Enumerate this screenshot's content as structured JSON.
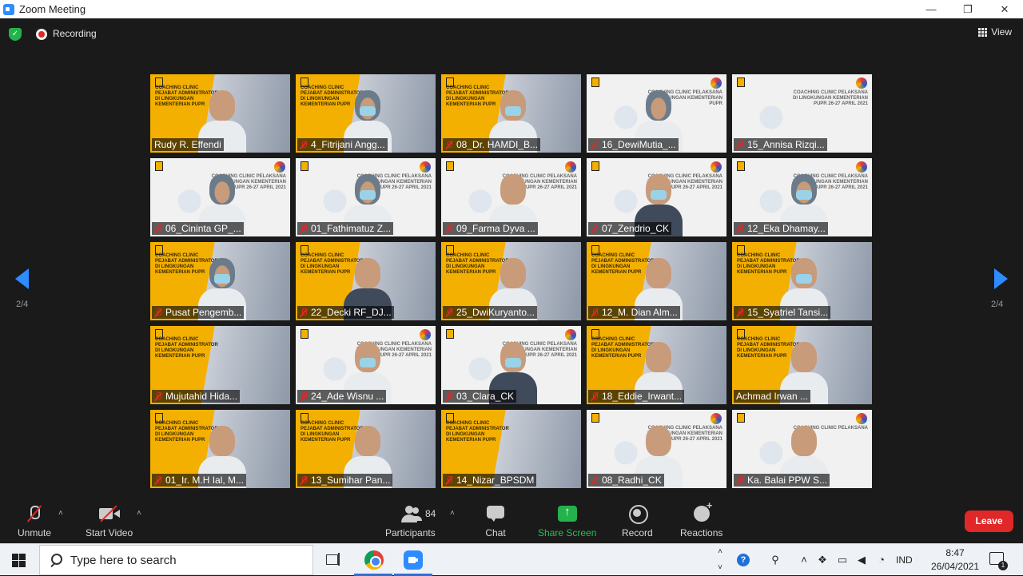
{
  "window": {
    "title": "Zoom Meeting",
    "minimize": "—",
    "restore": "❐",
    "close": "✕"
  },
  "meeting": {
    "recording_label": "Recording",
    "view_label": "View",
    "page_left": "2/4",
    "page_right": "2/4",
    "tiles": [
      {
        "name": "Rudy R. Effendi",
        "muted": false,
        "bg": "yellow",
        "banner": "COACHING CLINIC PEJABAT ADMINISTRATOR DI LINGKUNGAN KEMENTERIAN PUPR",
        "person": "plain",
        "mask": false
      },
      {
        "name": "4_Fitrijani Angg...",
        "muted": true,
        "bg": "yellow",
        "banner": "COACHING CLINIC PEJABAT ADMINISTRATOR DI LINGKUNGAN KEMENTERIAN PUPR",
        "person": "hijab",
        "mask": true
      },
      {
        "name": "08_Dr. HAMDI_B...",
        "muted": true,
        "bg": "yellow",
        "banner": "COACHING CLINIC PEJABAT ADMINISTRATOR DI LINGKUNGAN KEMENTERIAN PUPR",
        "person": "plain",
        "mask": true
      },
      {
        "name": "16_DewiMutia_...",
        "muted": true,
        "bg": "white",
        "banner": "COACHING CLINIC PELAKSANA DI LINGKUNGAN KEMENTERIAN PUPR",
        "person": "hijab",
        "mask": false
      },
      {
        "name": "15_Annisa Rizqi...",
        "muted": true,
        "bg": "white",
        "banner": "COACHING CLINIC PELAKSANA DI LINGKUNGAN KEMENTERIAN PUPR 26-27 APRIL 2021",
        "person": "none",
        "mask": false
      },
      {
        "name": "06_Cininta GP_...",
        "muted": true,
        "bg": "white",
        "banner": "COACHING CLINIC PELAKSANA DI LINGKUNGAN KEMENTERIAN PUPR 26-27 APRIL 2021",
        "person": "hijab",
        "mask": false
      },
      {
        "name": "01_Fathimatuz Z...",
        "muted": true,
        "bg": "white",
        "banner": "COACHING CLINIC PELAKSANA DI LINGKUNGAN KEMENTERIAN PUPR 26-27 APRIL 2021",
        "person": "hijab",
        "mask": true
      },
      {
        "name": "09_Farma Dyva ...",
        "muted": true,
        "bg": "white",
        "banner": "COACHING CLINIC PELAKSANA DI LINGKUNGAN KEMENTERIAN PUPR 26-27 APRIL 2021",
        "person": "plain",
        "mask": false
      },
      {
        "name": "07_Zendrio_CK",
        "muted": true,
        "bg": "white",
        "banner": "COACHING CLINIC PELAKSANA DI LINGKUNGAN KEMENTERIAN PUPR 26-27 APRIL 2021",
        "person": "dark",
        "mask": true
      },
      {
        "name": "12_Eka Dhamay...",
        "muted": true,
        "bg": "white",
        "banner": "COACHING CLINIC PELAKSANA DI LINGKUNGAN KEMENTERIAN PUPR 26-27 APRIL 2021",
        "person": "hijab",
        "mask": true
      },
      {
        "name": "Pusat Pengemb...",
        "muted": true,
        "bg": "yellow",
        "banner": "COACHING CLINIC PEJABAT ADMINISTRATOR DI LINGKUNGAN KEMENTERIAN PUPR",
        "person": "hijab",
        "mask": true
      },
      {
        "name": "22_Decki RF_DJ...",
        "muted": true,
        "bg": "yellow",
        "banner": "COACHING CLINIC PEJABAT ADMINISTRATOR DI LINGKUNGAN KEMENTERIAN PUPR",
        "person": "dark",
        "mask": false
      },
      {
        "name": "25_DwiKuryanto...",
        "muted": true,
        "bg": "yellow",
        "banner": "COACHING CLINIC PEJABAT ADMINISTRATOR DI LINGKUNGAN KEMENTERIAN PUPR",
        "person": "plain",
        "mask": false
      },
      {
        "name": "12_M. Dian Alm...",
        "muted": true,
        "bg": "yellow",
        "banner": "COACHING CLINIC PEJABAT ADMINISTRATOR DI LINGKUNGAN KEMENTERIAN PUPR",
        "person": "plain",
        "mask": false
      },
      {
        "name": "15_Syatriel Tansi...",
        "muted": true,
        "bg": "yellow",
        "banner": "COACHING CLINIC PEJABAT ADMINISTRATOR DI LINGKUNGAN KEMENTERIAN PUPR",
        "person": "plain",
        "mask": true
      },
      {
        "name": "Mujutahid Hida...",
        "muted": true,
        "bg": "yellow",
        "banner": "COACHING CLINIC PEJABAT ADMINISTRATOR DI LINGKUNGAN KEMENTERIAN PUPR",
        "person": "none",
        "mask": false
      },
      {
        "name": "24_Ade Wisnu ...",
        "muted": true,
        "bg": "white",
        "banner": "COACHING CLINIC PELAKSANA DI LINGKUNGAN KEMENTERIAN PUPR 26-27 APRIL 2021",
        "person": "plain",
        "mask": true
      },
      {
        "name": "03_Clara_CK",
        "muted": true,
        "bg": "white",
        "banner": "COACHING CLINIC PELAKSANA DI LINGKUNGAN KEMENTERIAN PUPR 26-27 APRIL 2021",
        "person": "dark",
        "mask": true
      },
      {
        "name": "18_Eddie_Irwant...",
        "muted": true,
        "bg": "yellow",
        "banner": "COACHING CLINIC PEJABAT ADMINISTRATOR DI LINGKUNGAN KEMENTERIAN PUPR",
        "person": "plain",
        "mask": false
      },
      {
        "name": "Achmad Irwan ...",
        "muted": false,
        "bg": "yellow",
        "banner": "COACHING CLINIC PEJABAT ADMINISTRATOR DI LINGKUNGAN KEMENTERIAN PUPR",
        "person": "plain",
        "mask": false
      },
      {
        "name": "01_Ir. M.H Ial, M...",
        "muted": true,
        "bg": "yellow",
        "banner": "COACHING CLINIC PEJABAT ADMINISTRATOR DI LINGKUNGAN KEMENTERIAN PUPR",
        "person": "plain",
        "mask": false
      },
      {
        "name": "13_Sumihar Pan...",
        "muted": true,
        "bg": "yellow",
        "banner": "COACHING CLINIC PEJABAT ADMINISTRATOR DI LINGKUNGAN KEMENTERIAN PUPR",
        "person": "plain",
        "mask": false
      },
      {
        "name": "14_Nizar_BPSDM",
        "muted": true,
        "bg": "yellow",
        "banner": "COACHING CLINIC PEJABAT ADMINISTRATOR DI LINGKUNGAN KEMENTERIAN PUPR",
        "person": "none",
        "mask": false
      },
      {
        "name": "08_Radhi_CK",
        "muted": true,
        "bg": "white",
        "banner": "COACHING CLINIC PELAKSANA DI LINGKUNGAN KEMENTERIAN PUPR 26-27 APRIL 2021",
        "person": "plain",
        "mask": false
      },
      {
        "name": "Ka. Balai PPW S...",
        "muted": true,
        "bg": "white",
        "banner": "COACHING CLINIC PELAKSANA",
        "person": "plain",
        "mask": false
      }
    ]
  },
  "toolbar": {
    "unmute": "Unmute",
    "start_video": "Start Video",
    "participants": "Participants",
    "participant_count": "84",
    "chat": "Chat",
    "share_screen": "Share Screen",
    "record": "Record",
    "reactions": "Reactions",
    "leave": "Leave",
    "caret": "˄"
  },
  "taskbar": {
    "search_placeholder": "Type here to search",
    "language": "IND",
    "time": "8:47",
    "date": "26/04/2021",
    "notification_count": "1"
  }
}
